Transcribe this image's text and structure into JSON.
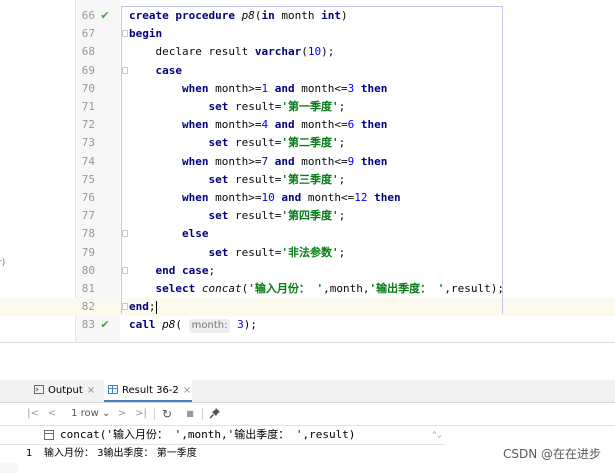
{
  "editor": {
    "side_fragment": "r)",
    "lines": [
      {
        "n": "66",
        "tokens": [
          [
            "create",
            "kw"
          ],
          [
            " ",
            ""
          ],
          [
            "procedure",
            "kw"
          ],
          [
            " ",
            ""
          ],
          [
            "p8",
            "it"
          ],
          [
            "(",
            ""
          ],
          [
            "in",
            "kw"
          ],
          [
            " month ",
            ""
          ],
          [
            "int",
            "kw"
          ],
          [
            ")",
            ""
          ]
        ]
      },
      {
        "n": "67",
        "tokens": [
          [
            "begin",
            "kw"
          ]
        ]
      },
      {
        "n": "68",
        "tokens": [
          [
            "    declare result ",
            ""
          ],
          [
            "varchar",
            "kw"
          ],
          [
            "(",
            ""
          ],
          [
            "10",
            "num"
          ],
          [
            ");",
            ""
          ]
        ]
      },
      {
        "n": "69",
        "tokens": [
          [
            "    ",
            ""
          ],
          [
            "case",
            "kw"
          ]
        ]
      },
      {
        "n": "70",
        "tokens": [
          [
            "        ",
            ""
          ],
          [
            "when",
            "kw"
          ],
          [
            " month>=",
            ""
          ],
          [
            "1",
            "num"
          ],
          [
            " ",
            ""
          ],
          [
            "and",
            "kw"
          ],
          [
            " month<=",
            ""
          ],
          [
            "3",
            "num"
          ],
          [
            " ",
            ""
          ],
          [
            "then",
            "kw"
          ]
        ]
      },
      {
        "n": "71",
        "tokens": [
          [
            "            ",
            ""
          ],
          [
            "set",
            "kw"
          ],
          [
            " result=",
            ""
          ],
          [
            "'第一季度'",
            "str"
          ],
          [
            ";",
            ""
          ]
        ]
      },
      {
        "n": "72",
        "tokens": [
          [
            "        ",
            ""
          ],
          [
            "when",
            "kw"
          ],
          [
            " month>=",
            ""
          ],
          [
            "4",
            "num"
          ],
          [
            " ",
            ""
          ],
          [
            "and",
            "kw"
          ],
          [
            " month<=",
            ""
          ],
          [
            "6",
            "num"
          ],
          [
            " ",
            ""
          ],
          [
            "then",
            "kw"
          ]
        ]
      },
      {
        "n": "73",
        "tokens": [
          [
            "            ",
            ""
          ],
          [
            "set",
            "kw"
          ],
          [
            " result=",
            ""
          ],
          [
            "'第二季度'",
            "str"
          ],
          [
            ";",
            ""
          ]
        ]
      },
      {
        "n": "74",
        "tokens": [
          [
            "        ",
            ""
          ],
          [
            "when",
            "kw"
          ],
          [
            " month>=",
            ""
          ],
          [
            "7",
            "num"
          ],
          [
            " ",
            ""
          ],
          [
            "and",
            "kw"
          ],
          [
            " month<=",
            ""
          ],
          [
            "9",
            "num"
          ],
          [
            " ",
            ""
          ],
          [
            "then",
            "kw"
          ]
        ]
      },
      {
        "n": "75",
        "tokens": [
          [
            "            ",
            ""
          ],
          [
            "set",
            "kw"
          ],
          [
            " result=",
            ""
          ],
          [
            "'第三季度'",
            "str"
          ],
          [
            ";",
            ""
          ]
        ]
      },
      {
        "n": "76",
        "tokens": [
          [
            "        ",
            ""
          ],
          [
            "when",
            "kw"
          ],
          [
            " month>=",
            ""
          ],
          [
            "10",
            "num"
          ],
          [
            " ",
            ""
          ],
          [
            "and",
            "kw"
          ],
          [
            " month<=",
            ""
          ],
          [
            "12",
            "num"
          ],
          [
            " ",
            ""
          ],
          [
            "then",
            "kw"
          ]
        ]
      },
      {
        "n": "77",
        "tokens": [
          [
            "            ",
            ""
          ],
          [
            "set",
            "kw"
          ],
          [
            " result=",
            ""
          ],
          [
            "'第四季度'",
            "str"
          ],
          [
            ";",
            ""
          ]
        ]
      },
      {
        "n": "78",
        "tokens": [
          [
            "        ",
            ""
          ],
          [
            "else",
            "kw"
          ]
        ]
      },
      {
        "n": "79",
        "tokens": [
          [
            "            ",
            ""
          ],
          [
            "set",
            "kw"
          ],
          [
            " result=",
            ""
          ],
          [
            "'非法参数'",
            "str"
          ],
          [
            ";",
            ""
          ]
        ]
      },
      {
        "n": "80",
        "tokens": [
          [
            "    ",
            ""
          ],
          [
            "end",
            "kw"
          ],
          [
            " ",
            ""
          ],
          [
            "case",
            "kw"
          ],
          [
            ";",
            ""
          ]
        ]
      },
      {
        "n": "81",
        "tokens": [
          [
            "    ",
            ""
          ],
          [
            "select",
            "kw"
          ],
          [
            " ",
            ""
          ],
          [
            "concat",
            "it"
          ],
          [
            "(",
            ""
          ],
          [
            "'输入月份： '",
            "str"
          ],
          [
            ",month,",
            ""
          ],
          [
            "'输出季度： '",
            "str"
          ],
          [
            ",result);",
            ""
          ]
        ]
      },
      {
        "n": "82",
        "tokens": [
          [
            "end",
            "kw"
          ],
          [
            ";",
            ""
          ]
        ]
      },
      {
        "n": "83",
        "tokens": [
          [
            "call",
            "kw"
          ],
          [
            " ",
            ""
          ],
          [
            "p8",
            "it"
          ],
          [
            "( ",
            ""
          ],
          [
            "month:",
            "hint"
          ],
          [
            " ",
            ""
          ],
          [
            "3",
            "num"
          ],
          [
            ");",
            ""
          ]
        ]
      }
    ]
  },
  "tabs": [
    {
      "label": "Output",
      "close": "×",
      "icon": "output-icon",
      "active": false
    },
    {
      "label": "Result 36-2",
      "close": "×",
      "icon": "table-icon",
      "active": true
    }
  ],
  "toolbar": {
    "first": "|<",
    "prev": "<",
    "rows": "1 row",
    "rows_caret": "⌄",
    "next": ">",
    "last": ">|",
    "refresh": "↻",
    "stop": "■",
    "pin": "📌"
  },
  "grid": {
    "column_icon": "column-icon",
    "column": "concat('输入月份： ',month,'输出季度： ',result)",
    "sort": "⌃⌄",
    "rows": [
      {
        "num": "1",
        "value": "输入月份： 3输出季度： 第一季度"
      }
    ]
  },
  "watermark": "CSDN @在在进步",
  "colors": {
    "keyword": "#000080",
    "string": "#067d17",
    "number": "#0000ff",
    "check": "#4a9c49",
    "active_tab": "#4083c9"
  }
}
